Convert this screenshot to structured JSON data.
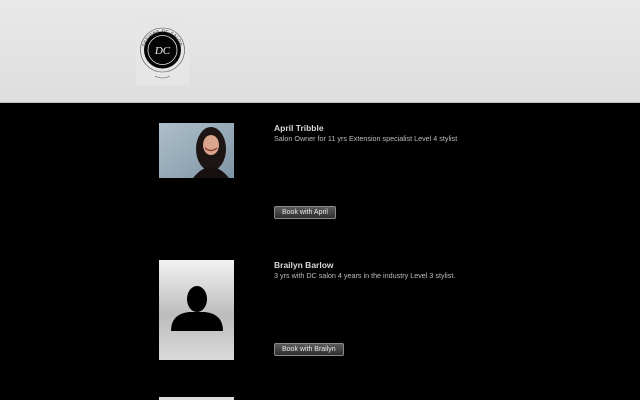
{
  "header": {
    "logo_initials": "DC",
    "logo_arc_text": "DESIGNS DC SALON"
  },
  "staff": [
    {
      "name": "April Tribble",
      "bio": "Salon Owner for 11 yrs Extension specialist Level 4 stylist",
      "book_label": "Book with April",
      "photo": "portrait-photo"
    },
    {
      "name": "Brailyn Barlow",
      "bio": "3 yrs with DC salon 4 years in the industry Level 3 stylist.",
      "book_label": "Book with Brailyn",
      "photo": "default-avatar-silhouette-icon"
    },
    {
      "name": "",
      "bio": "",
      "book_label": "",
      "photo": "portrait-photo"
    }
  ],
  "colors": {
    "page_background": "#000000",
    "header_background": "#e2e2e2",
    "name_text": "#d8d8d8",
    "bio_text": "#bdbdbd",
    "button_background": "#3f3f3f"
  }
}
